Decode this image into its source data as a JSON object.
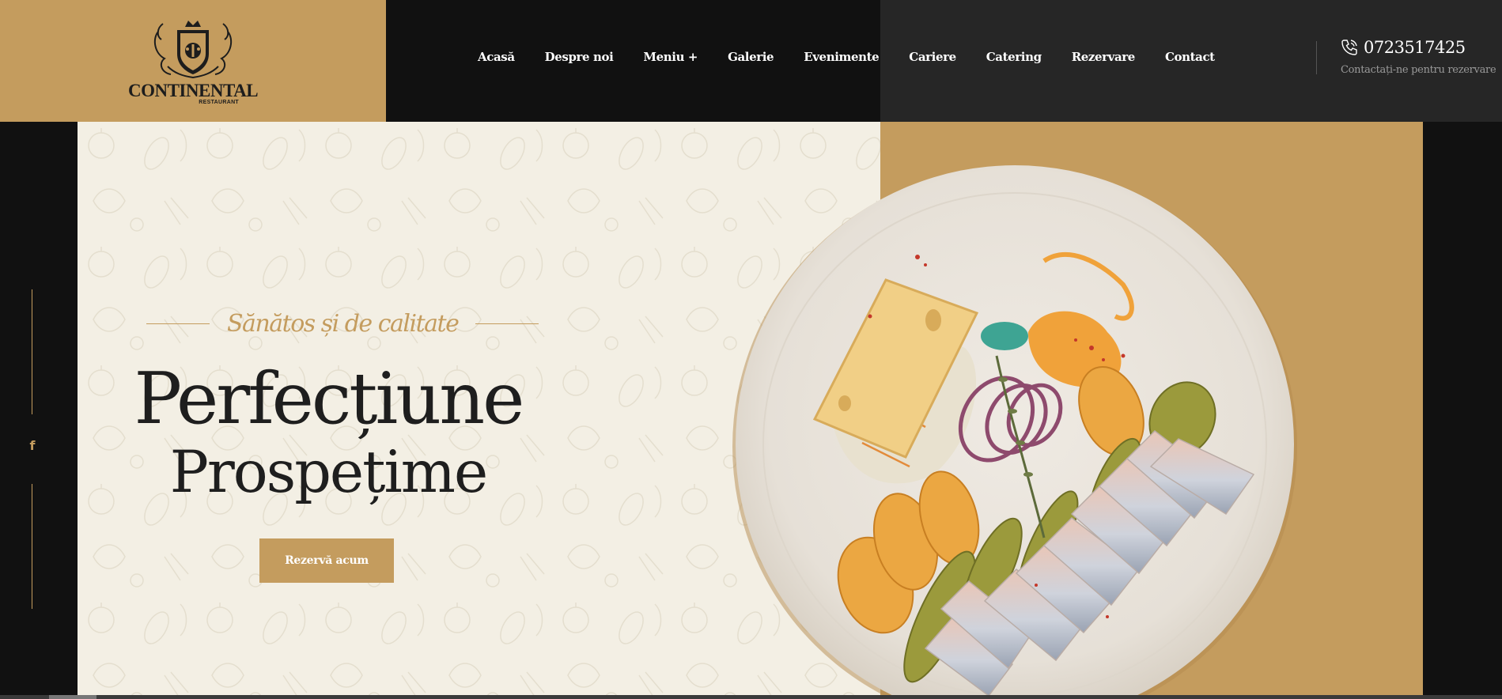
{
  "brand": {
    "name": "CONTINENTAL",
    "sub": "RESTAURANT",
    "accent": "#c49c5e"
  },
  "nav": {
    "items": [
      {
        "label": "Acasă"
      },
      {
        "label": "Despre noi"
      },
      {
        "label": "Meniu +"
      },
      {
        "label": "Galerie"
      },
      {
        "label": "Evenimente"
      },
      {
        "label": "Cariere"
      },
      {
        "label": "Catering"
      },
      {
        "label": "Rezervare"
      },
      {
        "label": "Contact"
      }
    ]
  },
  "contact": {
    "icon": "phone-icon",
    "phone": "0723517425",
    "subtitle": "Contactați-ne pentru rezervare"
  },
  "social": {
    "icon": "facebook-icon",
    "glyph": "f"
  },
  "hero": {
    "tagline": "Sănătos și de calitate",
    "title_line1": "Perfecțiune",
    "title_line2": "Prospețime",
    "cta_label": "Rezervă acum"
  },
  "colors": {
    "gold": "#c49c5e",
    "cream": "#f3efe4",
    "dark": "#111111",
    "header_gray": "#262626"
  }
}
